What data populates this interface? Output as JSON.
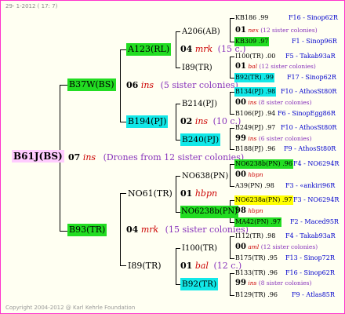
{
  "header_date": "29- 1-2012 ( 17: 7)",
  "footer": "Copyright 2004-2012 @ Karl Kehrle Foundation",
  "root": {
    "label": "B61J(BS)",
    "num": "07",
    "ins": "ins",
    "note": "(Drones from 12 sister colonies)"
  },
  "gen1": [
    {
      "label": "B37W(BS)",
      "num": "06",
      "ins": "ins",
      "note": "(5 sister colonies)"
    },
    {
      "label": "B93(TR)",
      "num": "04",
      "ins": "mrk",
      "note": "(15 sister colonies)"
    }
  ],
  "gen2": [
    {
      "label": "A123(RL)",
      "num": "04",
      "ins": "mrk",
      "note": "(15 c.)"
    },
    {
      "label": "B194(PJ)",
      "num": "02",
      "ins": "ins",
      "note": "(10 c.)"
    },
    {
      "label": "NO61(TR)",
      "num": "01",
      "ins": "hbpn",
      "note": ""
    },
    {
      "label": "I89(TR)",
      "num": "01",
      "ins": "bal",
      "note": "(12 c.)"
    }
  ],
  "gen3": [
    {
      "label": "A206(AB)",
      "num": "01",
      "ins": "nex",
      "note": "(12 sister colonies)"
    },
    {
      "label": "I89(TR)",
      "num": "01",
      "ins": "bal",
      "note": "(12 sister colonies)"
    },
    {
      "label": "B214(PJ)",
      "num": "00",
      "ins": "ins",
      "note": "(8 sister colonies)"
    },
    {
      "label": "B240(PJ)",
      "num": "99",
      "ins": "ins",
      "note": "(6 sister colonies)"
    },
    {
      "label": "NO638(PN)",
      "num": "00",
      "ins": "hbpn",
      "note": ""
    },
    {
      "label": "NO6238b(PN)",
      "num": "98",
      "ins": "hbpn",
      "note": ""
    },
    {
      "label": "I100(TR)",
      "num": "00",
      "ins": "aml",
      "note": "(12 sister colonies)"
    },
    {
      "label": "B92(TR)",
      "num": "99",
      "ins": "ins",
      "note": "(8 sister colonies)"
    }
  ],
  "gen4": [
    {
      "label": "KB186 .99",
      "right": "F16 - Sinop62R"
    },
    {
      "label": "KB309 .97",
      "right": "F1 - Sinop96R"
    },
    {
      "label": "I100(TR) .00",
      "right": "F5 - Takab93aR"
    },
    {
      "label": "B92(TR) .99",
      "right": "F17 - Sinop62R"
    },
    {
      "label": "B134(PJ) .98",
      "right": "F10 - AthosSt80R"
    },
    {
      "label": "B106(PJ) .94",
      "right": "F6 - SinopEgg86R"
    },
    {
      "label": "B249(PJ) .97",
      "right": "F10 - AthosSt80R"
    },
    {
      "label": "B188(PJ) .96",
      "right": "F9 - AthosSt80R"
    },
    {
      "label": "NO6238b(PN) .96",
      "right": "F4 - NO6294R"
    },
    {
      "label": "A39(PN) .98",
      "right": "F3 - «ankiri96R"
    },
    {
      "label": "NO6238a(PN) .97",
      "right": "F3 - NO6294R"
    },
    {
      "label": "MA42(PN) .97",
      "right": "F2 - Maced95R"
    },
    {
      "label": "I112(TR) .98",
      "right": "F4 - Takab93aR"
    },
    {
      "label": "B175(TR) .95",
      "right": "F13 - Sinop72R"
    },
    {
      "label": "B133(TR) .96",
      "right": "F16 - Sinop62R"
    },
    {
      "label": "B129(TR) .96",
      "right": "F9 - Atlas85R"
    }
  ]
}
